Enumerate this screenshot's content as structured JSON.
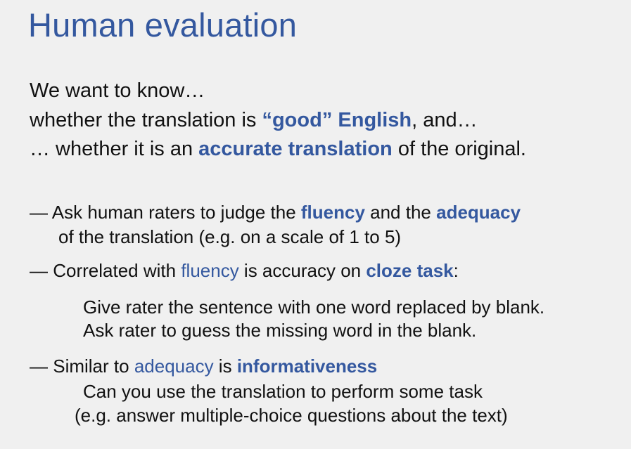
{
  "slide": {
    "title": "Human evaluation",
    "intro": {
      "line1": "We want to know…",
      "line2": {
        "p1": "whether the translation is ",
        "h1": "“good” English",
        "p2": ", and…"
      },
      "line3": {
        "p1": "… whether it is an ",
        "h1": "accurate translation",
        "p2": " of the original."
      }
    },
    "bullet1": {
      "p1": "— Ask human raters to judge the ",
      "h1": "fluency",
      "p2": " and the ",
      "h2": "adequacy",
      "cont": "of the translation (e.g. on a scale of 1 to 5)"
    },
    "bullet2": {
      "p1": "— Correlated with ",
      "h1": "fluency",
      "p2": " is accuracy on ",
      "h2": "cloze task",
      "p3": ":",
      "sub1": "Give rater the sentence with one word replaced by blank.",
      "sub2": "Ask rater to guess the missing word in the blank."
    },
    "bullet3": {
      "p1": "— Similar to ",
      "h1": "adequacy",
      "p2": " is ",
      "h2": "informativeness",
      "sub1": "Can you use the translation to perform some task",
      "sub2": "(e.g. answer multiple-choice questions about the text)"
    },
    "accent_color": "#34589f"
  }
}
